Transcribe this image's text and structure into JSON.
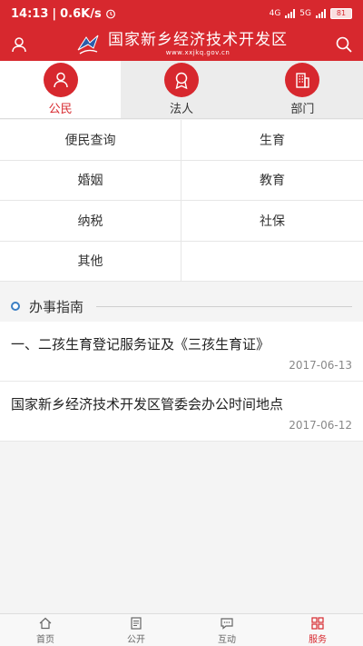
{
  "status_bar": {
    "time": "14:13",
    "speed": "0.6K/s",
    "net1": "4G",
    "net2": "5G",
    "battery": "81"
  },
  "header": {
    "title": "国家新乡经济技术开发区",
    "url": "www.xxjkq.gov.cn",
    "accent": "#d7282e"
  },
  "tabs": [
    {
      "label": "公民",
      "icon": "citizen-icon",
      "active": true
    },
    {
      "label": "法人",
      "icon": "badge-icon",
      "active": false
    },
    {
      "label": "部门",
      "icon": "building-icon",
      "active": false
    }
  ],
  "categories": [
    "便民查询",
    "生育",
    "婚姻",
    "教育",
    "纳税",
    "社保",
    "其他",
    ""
  ],
  "guide": {
    "title": "办事指南",
    "items": [
      {
        "title": "一、二孩生育登记服务证及《三孩生育证》",
        "date": "2017-06-13"
      },
      {
        "title": "国家新乡经济技术开发区管委会办公时间地点",
        "date": "2017-06-12"
      }
    ]
  },
  "bottom_nav": [
    {
      "label": "首页",
      "icon": "home-icon"
    },
    {
      "label": "公开",
      "icon": "document-icon"
    },
    {
      "label": "互动",
      "icon": "chat-icon"
    },
    {
      "label": "服务",
      "icon": "grid-icon"
    }
  ]
}
